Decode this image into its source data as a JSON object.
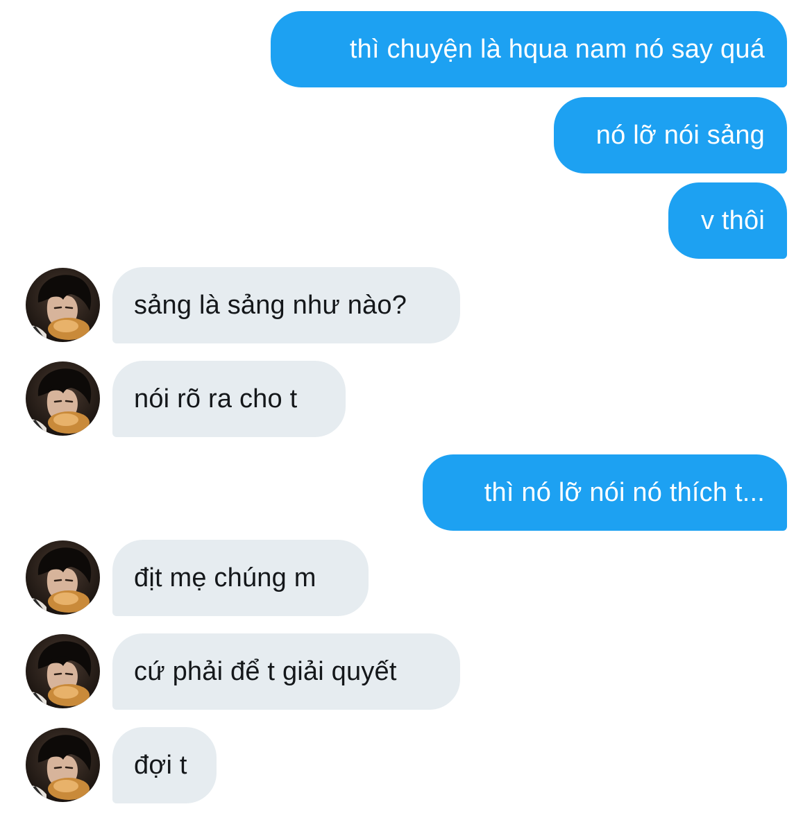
{
  "conversation": {
    "contact": {
      "avatar_icon": "profile-photo-avatar"
    },
    "colors": {
      "outgoing_bubble": "#1da1f2",
      "incoming_bubble": "#e6ecf0",
      "outgoing_text": "#ffffff",
      "incoming_text": "#14171a"
    },
    "messages": [
      {
        "direction": "outgoing",
        "text": "thì chuyện là hqua nam nó say quá"
      },
      {
        "direction": "outgoing",
        "text": "nó lỡ nói sảng"
      },
      {
        "direction": "outgoing",
        "text": "v thôi"
      },
      {
        "direction": "incoming",
        "text": "sảng là sảng như nào?"
      },
      {
        "direction": "incoming",
        "text": "nói rõ ra cho t"
      },
      {
        "direction": "outgoing",
        "text": "thì nó lỡ nói nó thích t..."
      },
      {
        "direction": "incoming",
        "text": "địt mẹ chúng m"
      },
      {
        "direction": "incoming",
        "text": "cứ phải để t giải quyết"
      },
      {
        "direction": "incoming",
        "text": "đợi t"
      }
    ]
  }
}
